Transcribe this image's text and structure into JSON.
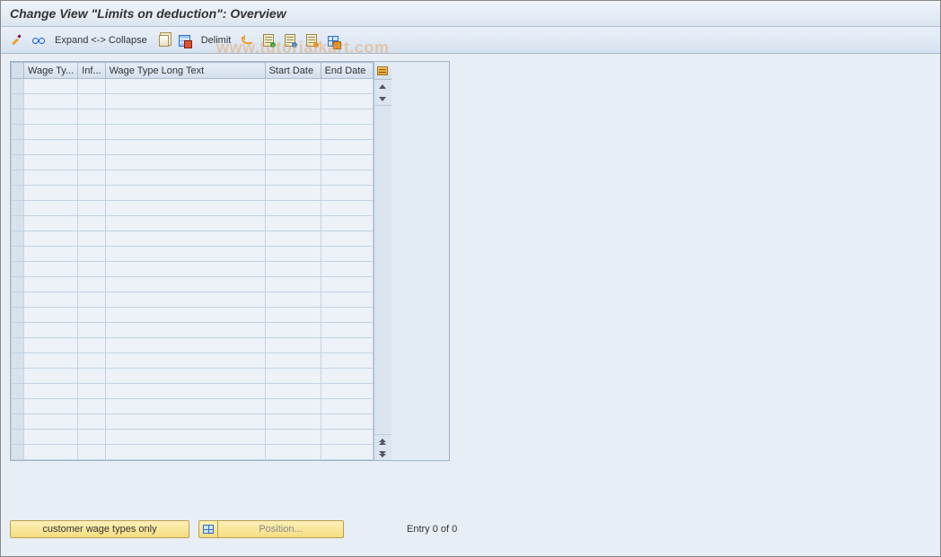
{
  "title": "Change View \"Limits on deduction\": Overview",
  "watermark": "www.tutorialkart.com",
  "toolbar": {
    "expand_collapse": "Expand <-> Collapse",
    "delimit": "Delimit"
  },
  "table": {
    "columns": {
      "wage_type": "Wage Ty...",
      "inf": "Inf...",
      "long_text": "Wage Type Long Text",
      "start_date": "Start Date",
      "end_date": "End Date"
    },
    "row_count": 25
  },
  "footer": {
    "customer_btn": "customer wage types only",
    "position_btn": "Position...",
    "entry_info": "Entry 0 of 0"
  }
}
